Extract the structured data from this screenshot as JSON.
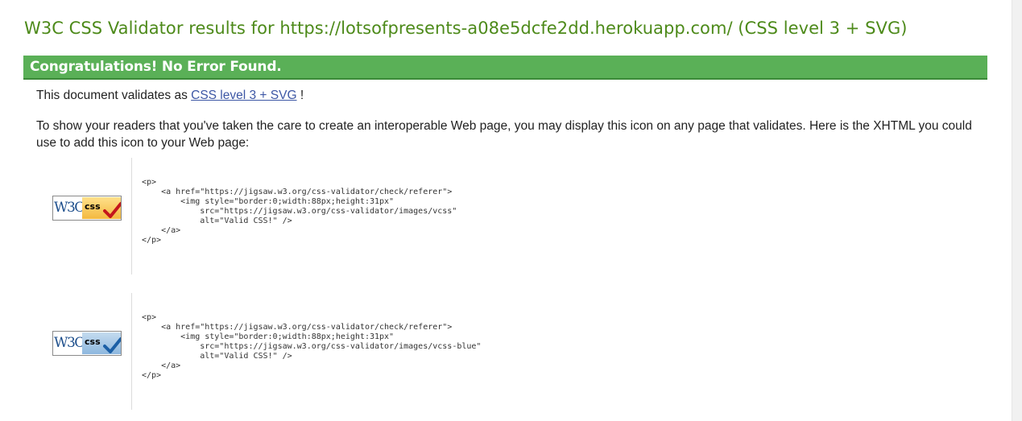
{
  "header": {
    "title": "W3C CSS Validator results for https://lotsofpresents-a08e5dcfe2dd.herokuapp.com/ (CSS level 3 + SVG)"
  },
  "banner": {
    "text": "Congratulations! No Error Found."
  },
  "body": {
    "validates_prefix": "This document validates as ",
    "validates_link": "CSS level 3 + SVG",
    "validates_suffix": " !",
    "icon_intro": "To show your readers that you've taken the care to create an interoperable Web page, you may display this icon on any page that validates. Here is the XHTML you could use to add this icon to your Web page:"
  },
  "badges": [
    {
      "w3c_text": "W3C",
      "css_text": "css",
      "style": "gold",
      "check_color": "#c4161c",
      "code": "<p>\n    <a href=\"https://jigsaw.w3.org/css-validator/check/referer\">\n        <img style=\"border:0;width:88px;height:31px\"\n            src=\"https://jigsaw.w3.org/css-validator/images/vcss\"\n            alt=\"Valid CSS!\" />\n    </a>\n</p>"
    },
    {
      "w3c_text": "W3C",
      "css_text": "css",
      "style": "blue",
      "check_color": "#1b5fa6",
      "code": "<p>\n    <a href=\"https://jigsaw.w3.org/css-validator/check/referer\">\n        <img style=\"border:0;width:88px;height:31px\"\n            src=\"https://jigsaw.w3.org/css-validator/images/vcss-blue\"\n            alt=\"Valid CSS!\" />\n    </a>\n</p>"
    }
  ],
  "colors": {
    "title_green": "#4d8a1a",
    "banner_green": "#5ab057",
    "link_blue": "#3d57a5"
  }
}
